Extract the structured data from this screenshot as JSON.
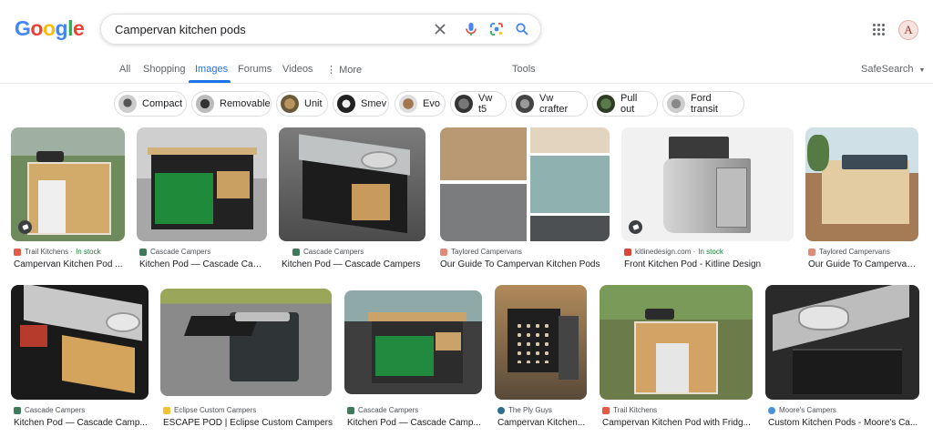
{
  "header": {
    "logo_letters": [
      "G",
      "o",
      "o",
      "g",
      "l",
      "e"
    ],
    "logo_colors": [
      "#4285f4",
      "#ea4335",
      "#fbbc05",
      "#4285f4",
      "#34a853",
      "#ea4335"
    ],
    "search_query": "Campervan kitchen pods",
    "avatar_letter": "A"
  },
  "tabs": [
    {
      "label": "All"
    },
    {
      "label": "Shopping"
    },
    {
      "label": "Images",
      "active": true
    },
    {
      "label": "Forums"
    },
    {
      "label": "Videos"
    },
    {
      "label": "More"
    }
  ],
  "tools_label": "Tools",
  "safesearch_label": "SafeSearch",
  "chips": [
    {
      "label": "Compact"
    },
    {
      "label": "Removable"
    },
    {
      "label": "Unit"
    },
    {
      "label": "Smev"
    },
    {
      "label": "Evo"
    },
    {
      "label": "Vw t5"
    },
    {
      "label": "Vw crafter"
    },
    {
      "label": "Pull out"
    },
    {
      "label": "Ford transit"
    }
  ],
  "results": [
    {
      "source": "Trail Kitchens",
      "in_stock": "In stock",
      "title": "Campervan Kitchen Pod ..."
    },
    {
      "source": "Cascade Campers",
      "title": "Kitchen Pod — Cascade Camp..."
    },
    {
      "source": "Cascade Campers",
      "title": "Kitchen Pod — Cascade Campers"
    },
    {
      "source": "Taylored Campervans",
      "title": "Our Guide To Campervan Kitchen Pods"
    },
    {
      "source": "kitlinedesign.com",
      "in_stock": "In stock",
      "title": "Front Kitchen Pod - Kitline Design"
    },
    {
      "source": "Taylored Campervans",
      "title": "Our Guide To Campervan..."
    },
    {
      "source": "Cascade Campers",
      "title": "Kitchen Pod — Cascade Camp..."
    },
    {
      "source": "Eclipse Custom Campers",
      "title": "ESCAPE POD | Eclipse Custom Campers"
    },
    {
      "source": "Cascade Campers",
      "title": "Kitchen Pod — Cascade Camp..."
    },
    {
      "source": "The Ply Guys",
      "title": "Campervan Kitchen..."
    },
    {
      "source": "Trail Kitchens",
      "title": "Campervan Kitchen Pod with Fridg..."
    },
    {
      "source": "Moore's Campers",
      "title": "Custom Kitchen Pods - Moore's Ca..."
    }
  ],
  "colors": {
    "accent": "#1a73e8",
    "in_stock": "#188038"
  }
}
